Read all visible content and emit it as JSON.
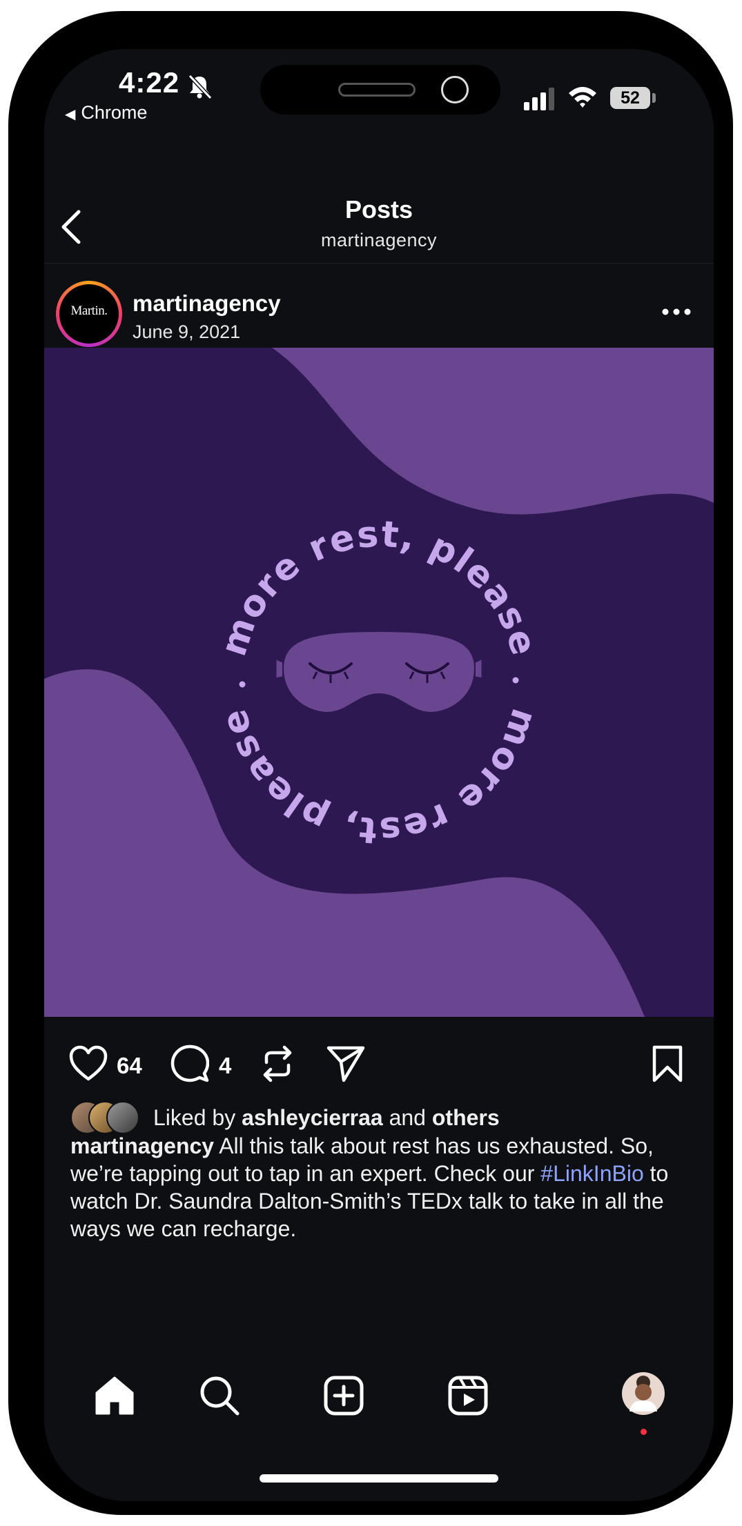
{
  "status_bar": {
    "time": "4:22",
    "back_app": "Chrome",
    "battery": "52"
  },
  "header": {
    "title": "Posts",
    "subtitle": "martinagency"
  },
  "post": {
    "avatar_text": "Martin.",
    "username": "martinagency",
    "date": "June 9, 2021",
    "image_text_top": "more rest, please",
    "image_text_bottom": "more rest, please",
    "colors": {
      "dark_purple": "#2d1851",
      "light_purple": "#6b4690",
      "text_lilac": "#c6a7ec"
    }
  },
  "actions": {
    "like_count": "64",
    "comment_count": "4"
  },
  "likes": {
    "prefix": "Liked by",
    "user": "ashleycierraa",
    "conjunction": "and",
    "others": "others"
  },
  "caption": {
    "username": "martinagency",
    "text_1": "All this talk about rest has us exhausted. So, we’re tapping out to tap in an expert. Check our",
    "hashtag": "#LinkInBio",
    "text_2": "to watch Dr. Saundra Dalton-Smith’s TEDx talk to take in all the ways we can recharge."
  },
  "nav": [
    "home-icon",
    "search-icon",
    "create-icon",
    "reels-icon",
    "profile-avatar"
  ]
}
